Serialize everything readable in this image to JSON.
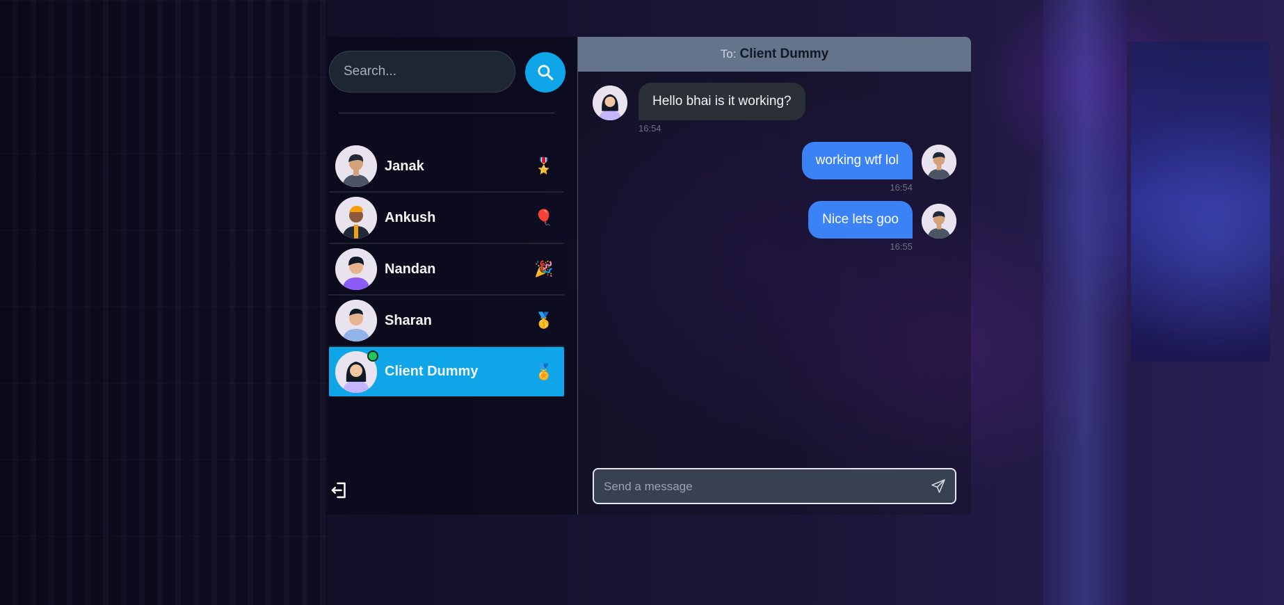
{
  "search": {
    "placeholder": "Search..."
  },
  "contacts": [
    {
      "name": "Janak",
      "emoji": "🎖️",
      "online": false,
      "active": false
    },
    {
      "name": "Ankush",
      "emoji": "🎈",
      "online": false,
      "active": false
    },
    {
      "name": "Nandan",
      "emoji": "🎉",
      "online": false,
      "active": false
    },
    {
      "name": "Sharan",
      "emoji": "🥇",
      "online": false,
      "active": false
    },
    {
      "name": "Client Dummy",
      "emoji": "🏅",
      "online": true,
      "active": true
    }
  ],
  "chat": {
    "to_label": "To:",
    "recipient": "Client Dummy",
    "messages": [
      {
        "direction": "incoming",
        "text": "Hello bhai is it working?",
        "time": "16:54"
      },
      {
        "direction": "outgoing",
        "text": "working wtf lol",
        "time": "16:54"
      },
      {
        "direction": "outgoing",
        "text": "Nice lets goo",
        "time": "16:55"
      }
    ],
    "composer_placeholder": "Send a message"
  },
  "colors": {
    "accent": "#0ea5e9",
    "outgoing_bubble": "#3b82f6",
    "incoming_bubble": "#2b2f37",
    "header": "#64748b",
    "online": "#22c55e"
  },
  "icons": {
    "search": "search-icon",
    "logout": "logout-icon",
    "send": "send-icon"
  }
}
